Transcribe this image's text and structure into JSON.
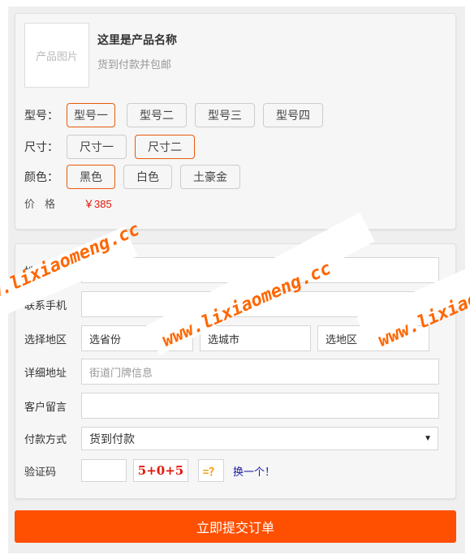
{
  "product": {
    "image_placeholder": "产品图片",
    "name": "这里是产品名称",
    "shipping_note": "货到付款并包邮"
  },
  "options": {
    "model": {
      "label": "型号：",
      "choices": [
        "型号一",
        "型号二",
        "型号三",
        "型号四"
      ],
      "selected": "型号一"
    },
    "size": {
      "label": "尺寸：",
      "choices": [
        "尺寸一",
        "尺寸二"
      ],
      "selected": "尺寸二"
    },
    "color": {
      "label": "颜色：",
      "choices": [
        "黑色",
        "白色",
        "土豪金"
      ],
      "selected": "黑色"
    }
  },
  "price": {
    "label": "价格",
    "value": "￥385"
  },
  "form": {
    "name_label": "姓名",
    "name_value": "",
    "phone_label": "联系手机",
    "phone_value": "",
    "region_label": "选择地区",
    "province_placeholder": "选省份",
    "city_placeholder": "选城市",
    "district_placeholder": "选地区",
    "address_label": "详细地址",
    "address_placeholder": "街道门牌信息",
    "note_label": "客户留言",
    "note_value": "",
    "payment_label": "付款方式",
    "payment_value": "货到付款",
    "captcha_label": "验证码",
    "captcha_value": "",
    "captcha_question": "5+0+5",
    "captcha_equals": "=？",
    "captcha_refresh": "换一个！"
  },
  "submit_label": "立即提交订单",
  "watermark": "www.lixiaomeng.cc",
  "colors": {
    "accent": "#ff4f00",
    "selected_border": "#e65a0b",
    "price": "#e0190c",
    "watermark": "#ff6600"
  }
}
